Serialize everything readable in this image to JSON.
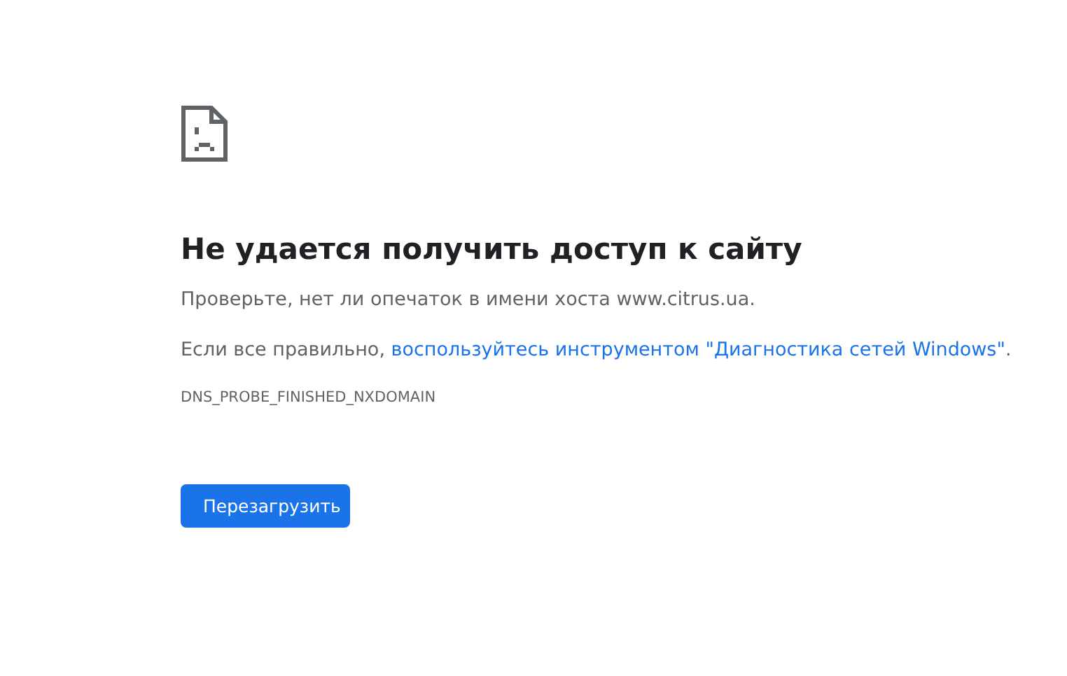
{
  "heading": "Не удается получить доступ к сайту",
  "hint": "Проверьте, нет ли опечаток в имени хоста www.citrus.ua.",
  "suggestion": {
    "before": "Если все правильно, ",
    "link": "воспользуйтесь инструментом \"Диагностика сетей Windows\"",
    "after": "."
  },
  "error_code": "DNS_PROBE_FINISHED_NXDOMAIN",
  "buttons": [
    "Перезагрузить"
  ]
}
